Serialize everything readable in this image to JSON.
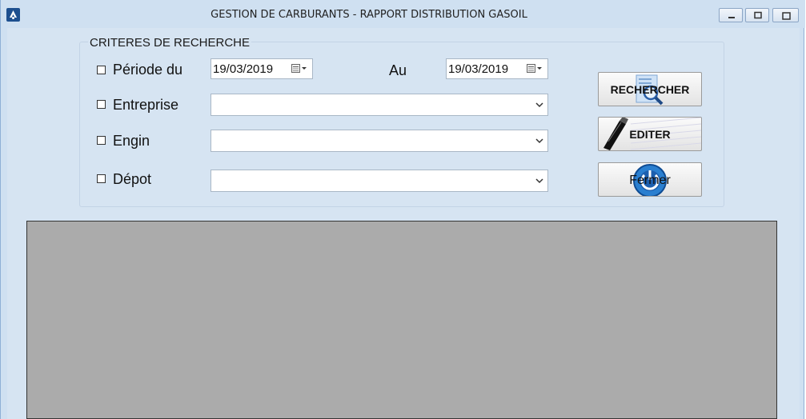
{
  "window": {
    "title": "GESTION DE CARBURANTS - RAPPORT DISTRIBUTION GASOIL"
  },
  "criteria": {
    "group_title": "CRITERES DE RECHERCHE",
    "periode_label": "Période du",
    "date_from": "19/03/2019",
    "au_label": "Au",
    "date_to": "19/03/2019",
    "entreprise_label": "Entreprise",
    "entreprise_value": "",
    "engin_label": "Engin",
    "engin_value": "",
    "depot_label": "Dépot",
    "depot_value": "",
    "checked": {
      "periode": false,
      "entreprise": false,
      "engin": false,
      "depot": false
    }
  },
  "buttons": {
    "rechercher": "RECHERCHER",
    "editer": "EDITER",
    "fermer": "Fermer"
  },
  "colors": {
    "grid_bg": "#ababab",
    "form_bg": "#d6e4f2"
  },
  "icons": [
    "app-icon",
    "minimize-icon",
    "maximize-icon",
    "close-icon",
    "calendar-icon",
    "magnifier-icon",
    "pen-icon",
    "power-icon"
  ]
}
